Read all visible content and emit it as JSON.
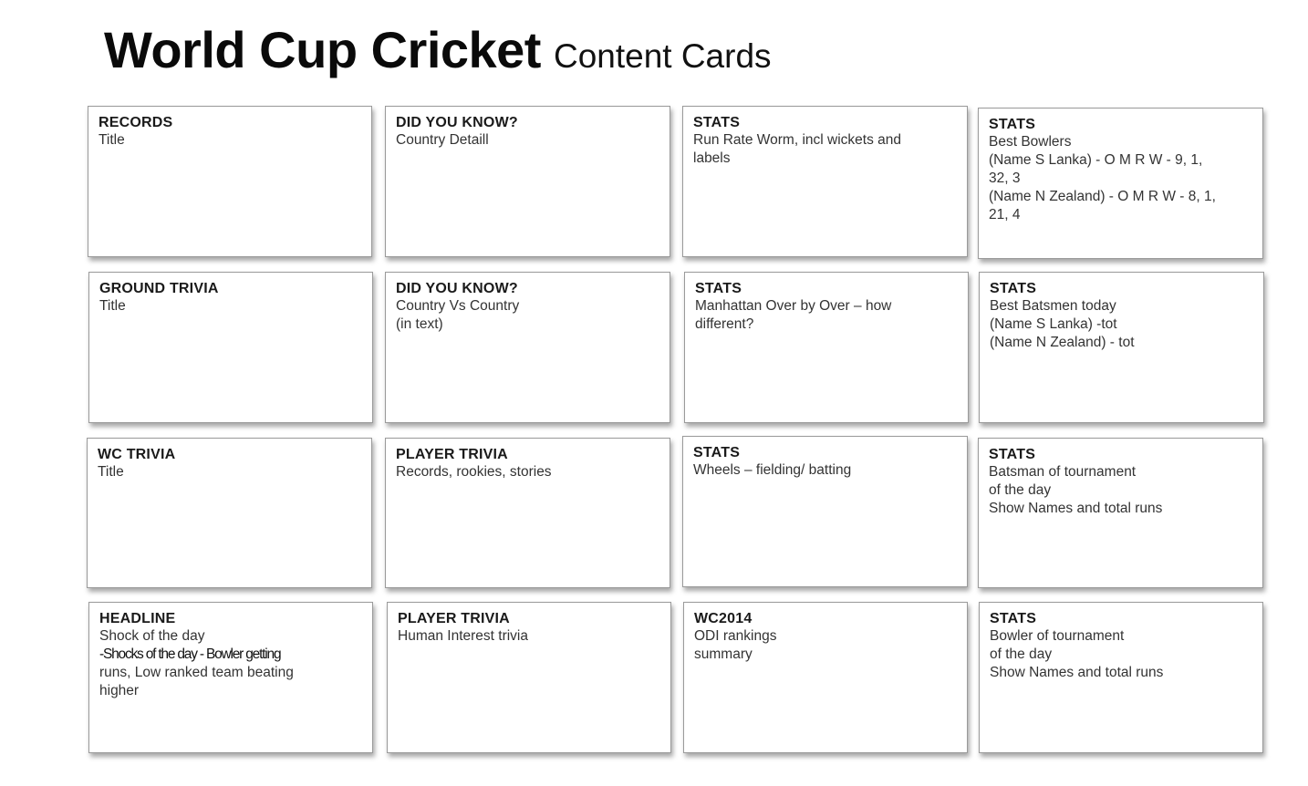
{
  "title": {
    "main": "World Cup Cricket",
    "sub": "Content Cards"
  },
  "cards": [
    {
      "heading": "RECORDS",
      "lines": [
        "Title"
      ]
    },
    {
      "heading": "DID YOU KNOW?",
      "lines": [
        "Country Detaill"
      ]
    },
    {
      "heading": "STATS",
      "lines": [
        "Run Rate Worm, incl wickets and",
        "labels"
      ]
    },
    {
      "heading": "STATS",
      "lines": [
        "Best Bowlers",
        "(Name S Lanka) - O M R W - 9, 1,",
        "32, 3",
        "(Name N Zealand) - O M R W - 8, 1,",
        "21, 4"
      ]
    },
    {
      "heading": "GROUND TRIVIA",
      "lines": [
        "Title"
      ]
    },
    {
      "heading": "DID YOU KNOW?",
      "lines": [
        "Country Vs Country",
        "(in text)"
      ]
    },
    {
      "heading": "STATS",
      "lines": [
        "Manhattan Over by Over – how",
        "different?"
      ]
    },
    {
      "heading": "STATS",
      "lines": [
        "Best Batsmen today",
        "(Name S Lanka) -tot",
        "(Name N Zealand) - tot"
      ]
    },
    {
      "heading": "WC TRIVIA",
      "lines": [
        "Title"
      ]
    },
    {
      "heading": "PLAYER TRIVIA",
      "lines": [
        "Records, rookies, stories"
      ]
    },
    {
      "heading": "STATS",
      "lines": [
        "Wheels – fielding/ batting"
      ]
    },
    {
      "heading": "STATS",
      "lines": [
        "Batsman of tournament",
        "of the day",
        "Show Names and total runs"
      ]
    },
    {
      "heading": "HEADLINE",
      "lines": [
        "Shock of the day",
        "-Shocks of the day - Bowler getting",
        "runs, Low ranked team beating",
        "higher"
      ]
    },
    {
      "heading": "PLAYER TRIVIA",
      "lines": [
        "Human Interest trivia"
      ]
    },
    {
      "heading": "WC2014",
      "lines": [
        "ODI rankings",
        "summary"
      ]
    },
    {
      "heading": "STATS",
      "lines": [
        "Bowler of tournament",
        "of the day",
        "Show Names and total runs"
      ]
    }
  ]
}
